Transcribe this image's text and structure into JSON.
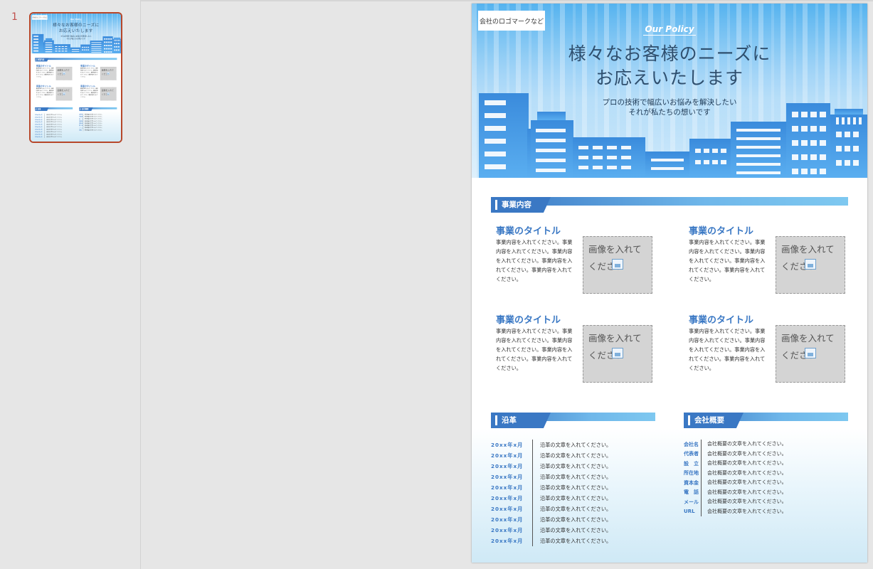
{
  "thumbnail": {
    "slide_number": "1"
  },
  "header": {
    "logo_text": "会社のロゴマークなど",
    "policy_label": "Our Policy",
    "title_line1": "様々なお客様のニーズに",
    "title_line2": "お応えいたします",
    "subtitle_line1": "プロの技術で幅広いお悩みを解決したい",
    "subtitle_line2": "それが私たちの想いです"
  },
  "business": {
    "heading": "事業内容",
    "items": [
      {
        "title": "事業のタイトル",
        "text": "事業内容を入れてください。事業内容を入れてください。事業内容を入れてください。事業内容を入れてください。事業内容を入れてください。",
        "image_placeholder": "画像を入れてください"
      },
      {
        "title": "事業のタイトル",
        "text": "事業内容を入れてください。事業内容を入れてください。事業内容を入れてください。事業内容を入れてください。事業内容を入れてください。",
        "image_placeholder": "画像を入れてください"
      },
      {
        "title": "事業のタイトル",
        "text": "事業内容を入れてください。事業内容を入れてください。事業内容を入れてください。事業内容を入れてください。事業内容を入れてください。",
        "image_placeholder": "画像を入れてください"
      },
      {
        "title": "事業のタイトル",
        "text": "事業内容を入れてください。事業内容を入れてください。事業内容を入れてください。事業内容を入れてください。事業内容を入れてください。",
        "image_placeholder": "画像を入れてください"
      }
    ]
  },
  "history": {
    "heading": "沿革",
    "rows": [
      {
        "date": "20xx年x月",
        "text": "沿革の文章を入れてください。"
      },
      {
        "date": "20xx年x月",
        "text": "沿革の文章を入れてください。"
      },
      {
        "date": "20xx年x月",
        "text": "沿革の文章を入れてください。"
      },
      {
        "date": "20xx年x月",
        "text": "沿革の文章を入れてください。"
      },
      {
        "date": "20xx年x月",
        "text": "沿革の文章を入れてください。"
      },
      {
        "date": "20xx年x月",
        "text": "沿革の文章を入れてください。"
      },
      {
        "date": "20xx年x月",
        "text": "沿革の文章を入れてください。"
      },
      {
        "date": "20xx年x月",
        "text": "沿革の文章を入れてください。"
      },
      {
        "date": "20xx年x月",
        "text": "沿革の文章を入れてください。"
      },
      {
        "date": "20xx年x月",
        "text": "沿革の文章を入れてください。"
      }
    ]
  },
  "company": {
    "heading": "会社概要",
    "rows": [
      {
        "label": "会社名",
        "text": "会社概要の文章を入れてください。"
      },
      {
        "label": "代表者",
        "text": "会社概要の文章を入れてください。"
      },
      {
        "label": "設　立",
        "text": "会社概要の文章を入れてください。"
      },
      {
        "label": "所在地",
        "text": "会社概要の文章を入れてください。"
      },
      {
        "label": "資本金",
        "text": "会社概要の文章を入れてください。"
      },
      {
        "label": "電　話",
        "text": "会社概要の文章を入れてください。"
      },
      {
        "label": "メール",
        "text": "会社概要の文章を入れてください。"
      },
      {
        "label": "URL",
        "text": "会社概要の文章を入れてください。"
      }
    ]
  },
  "colors": {
    "accent": "#3a78c4",
    "sky_top": "#55b3ef",
    "building": "#3f8fdb",
    "selection": "#b7472a"
  }
}
